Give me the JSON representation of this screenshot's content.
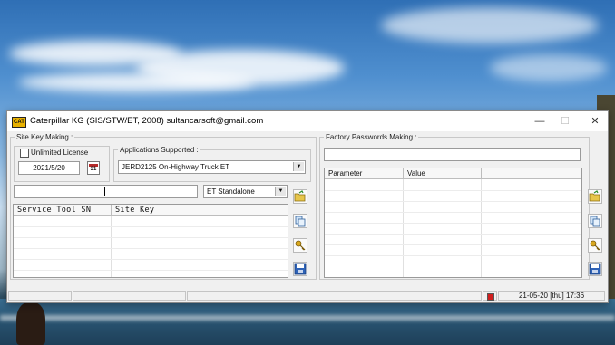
{
  "window": {
    "title": "Caterpillar KG (SIS/STW/ET, 2008) sultancarsoft@gmail.com",
    "icon_label": "CAT",
    "controls": [
      "minimize-icon",
      "maximize-icon",
      "close-icon"
    ],
    "minimize_glyph": "—",
    "maximize_glyph": "☐",
    "close_glyph": "✕"
  },
  "site_key": {
    "legend": "Site Key Making :",
    "unlimited_label": "Unlimited License",
    "unlimited_checked": false,
    "date_value": "2021/5/20",
    "calendar_label": "31",
    "apps_legend": "Applications Supported :",
    "app_selected": "JERD2125 On-Highway Truck ET",
    "sn_input_value": "",
    "mode_selected": "ET Standalone",
    "grid_headers": [
      "Service Tool SN",
      "Site Key",
      ""
    ]
  },
  "factory": {
    "legend": "Factory Passwords Making :",
    "input_value": "",
    "grid_headers": [
      "Parameter",
      "Value",
      ""
    ]
  },
  "toolbar_icons": [
    "open-folder-icon",
    "copy-icon",
    "keys-icon",
    "save-disk-icon"
  ],
  "status": {
    "datetime": "21-05-20 [thu] 17:36",
    "indicator_color": "#d01e1e"
  }
}
